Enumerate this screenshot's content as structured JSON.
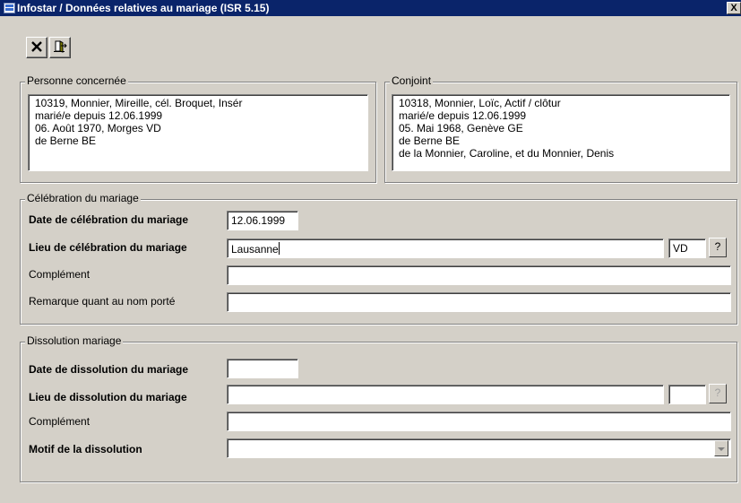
{
  "window": {
    "title": "Infostar / Données relatives au mariage (ISR 5.15)",
    "close_label": "X"
  },
  "toolbar": {
    "buttons": [
      {
        "icon": "close-x-icon"
      },
      {
        "icon": "exit-door-icon"
      }
    ]
  },
  "personne": {
    "legend": "Personne concernée",
    "lines": [
      "10319, Monnier, Mireille, cél. Broquet, Insér",
      "marié/e depuis 12.06.1999",
      "06. Août 1970, Morges VD",
      "de Berne BE"
    ]
  },
  "conjoint": {
    "legend": "Conjoint",
    "lines": [
      "10318, Monnier, Loïc, Actif / clôtur",
      "marié/e depuis 12.06.1999",
      "05. Mai 1968, Genève GE",
      "de Berne BE",
      "de la Monnier, Caroline, et du Monnier, Denis"
    ]
  },
  "celebration": {
    "legend": "Célébration du mariage",
    "date_label": "Date de célébration du mariage",
    "date_value": "12.06.1999",
    "lieu_label": "Lieu de célébration du mariage",
    "lieu_value": "Lausanne",
    "canton_value": "VD",
    "help_label": "?",
    "complement_label": "Complément",
    "complement_value": "",
    "remarque_label": "Remarque quant au nom porté",
    "remarque_value": ""
  },
  "dissolution": {
    "legend": "Dissolution mariage",
    "date_label": "Date de dissolution du mariage",
    "date_value": "",
    "lieu_label": "Lieu de dissolution du mariage",
    "lieu_value": "",
    "canton_value": "",
    "help_label": "?",
    "complement_label": "Complément",
    "complement_value": "",
    "motif_label": "Motif de la dissolution",
    "motif_value": ""
  },
  "colors": {
    "titlebar": "#0a246a",
    "face": "#d4d0c8"
  }
}
